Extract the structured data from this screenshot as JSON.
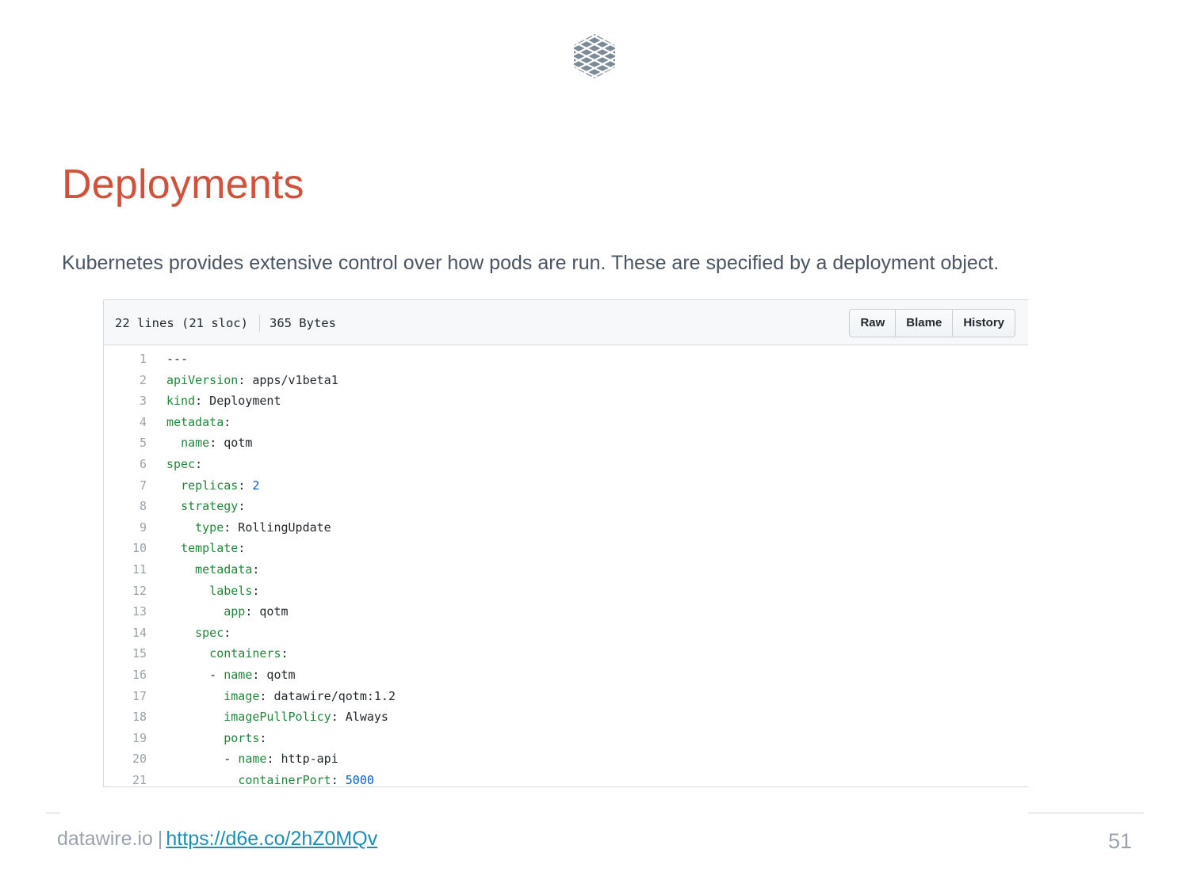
{
  "slide": {
    "title": "Deployments",
    "subtitle": "Kubernetes provides extensive control over how pods are run. These are specified by a deployment object."
  },
  "file": {
    "lines_info": "22 lines (21 sloc)",
    "size": "365 Bytes",
    "buttons": [
      "Raw",
      "Blame",
      "History"
    ],
    "code": [
      {
        "num": "1",
        "indent": "",
        "key": "",
        "text": "---",
        "num_value": ""
      },
      {
        "num": "2",
        "indent": "",
        "key": "apiVersion",
        "text": " apps/v1beta1",
        "num_value": ""
      },
      {
        "num": "3",
        "indent": "",
        "key": "kind",
        "text": " Deployment",
        "num_value": ""
      },
      {
        "num": "4",
        "indent": "",
        "key": "metadata",
        "text": "",
        "num_value": ""
      },
      {
        "num": "5",
        "indent": "  ",
        "key": "name",
        "text": " qotm",
        "num_value": ""
      },
      {
        "num": "6",
        "indent": "",
        "key": "spec",
        "text": "",
        "num_value": ""
      },
      {
        "num": "7",
        "indent": "  ",
        "key": "replicas",
        "text": " ",
        "num_value": "2"
      },
      {
        "num": "8",
        "indent": "  ",
        "key": "strategy",
        "text": "",
        "num_value": ""
      },
      {
        "num": "9",
        "indent": "    ",
        "key": "type",
        "text": " RollingUpdate",
        "num_value": ""
      },
      {
        "num": "10",
        "indent": "  ",
        "key": "template",
        "text": "",
        "num_value": ""
      },
      {
        "num": "11",
        "indent": "    ",
        "key": "metadata",
        "text": "",
        "num_value": ""
      },
      {
        "num": "12",
        "indent": "      ",
        "key": "labels",
        "text": "",
        "num_value": ""
      },
      {
        "num": "13",
        "indent": "        ",
        "key": "app",
        "text": " qotm",
        "num_value": ""
      },
      {
        "num": "14",
        "indent": "    ",
        "key": "spec",
        "text": "",
        "num_value": ""
      },
      {
        "num": "15",
        "indent": "      ",
        "key": "containers",
        "text": "",
        "num_value": ""
      },
      {
        "num": "16",
        "indent": "      - ",
        "key": "name",
        "text": " qotm",
        "num_value": ""
      },
      {
        "num": "17",
        "indent": "        ",
        "key": "image",
        "text": " datawire/qotm:1.2",
        "num_value": ""
      },
      {
        "num": "18",
        "indent": "        ",
        "key": "imagePullPolicy",
        "text": " Always",
        "num_value": ""
      },
      {
        "num": "19",
        "indent": "        ",
        "key": "ports",
        "text": "",
        "num_value": ""
      },
      {
        "num": "20",
        "indent": "        - ",
        "key": "name",
        "text": " http-api",
        "num_value": ""
      },
      {
        "num": "21",
        "indent": "          ",
        "key": "containerPort",
        "text": " ",
        "num_value": "5000"
      }
    ]
  },
  "footer": {
    "site": "datawire.io",
    "separator": "|",
    "link": "https://d6e.co/2hZ0MQv",
    "page_number": "51"
  },
  "colors": {
    "title": "#d0523a",
    "yaml_key": "#22863a",
    "yaml_number": "#005cc5",
    "link": "#1a8fb5",
    "logo": "#7d8b96"
  },
  "icons": {
    "logo": "datawire-lattice-logo-icon"
  }
}
